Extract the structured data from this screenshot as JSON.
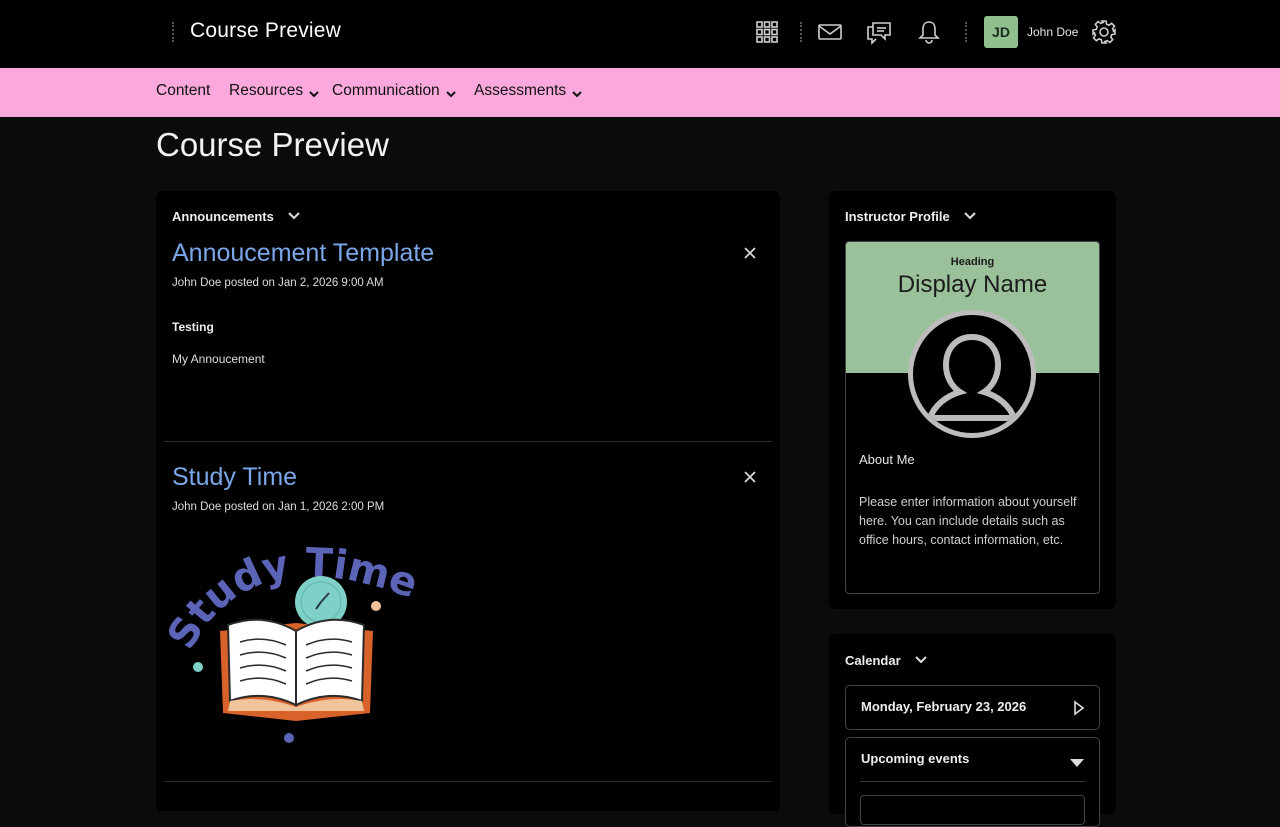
{
  "topbar": {
    "title": "Course Preview",
    "avatar_initials": "JD",
    "user_name": "John Doe",
    "icons": [
      "apps-grid-icon",
      "mail-icon",
      "chat-icon",
      "bell-icon",
      "gear-icon"
    ]
  },
  "nav": {
    "items": [
      {
        "label": "Content",
        "dropdown": false
      },
      {
        "label": "Resources",
        "dropdown": true
      },
      {
        "label": "Communication",
        "dropdown": true
      },
      {
        "label": "Assessments",
        "dropdown": true
      }
    ],
    "background": "#fba9dc"
  },
  "page": {
    "title": "Course Preview"
  },
  "announcements": {
    "header": "Announcements",
    "items": [
      {
        "title": "Annoucement Template",
        "meta": "John Doe posted on Jan 2, 2026 9:00 AM",
        "body_bold": "Testing",
        "body": "My Annoucement"
      },
      {
        "title": "Study Time",
        "meta": "John Doe posted on Jan 1, 2026 2:00 PM",
        "image_text": "Study Time"
      }
    ]
  },
  "profile": {
    "header": "Instructor Profile",
    "heading": "Heading",
    "display_name": "Display Name",
    "about_heading": "About Me",
    "about_text": "Please enter information about yourself here. You can include details such as office hours, contact information, etc."
  },
  "calendar": {
    "header": "Calendar",
    "date": "Monday, February 23, 2026",
    "upcoming": "Upcoming events"
  },
  "colors": {
    "accent_link": "#7aa7e8",
    "avatar_bg": "#8fbf8f",
    "profile_banner": "#9ac19a"
  }
}
